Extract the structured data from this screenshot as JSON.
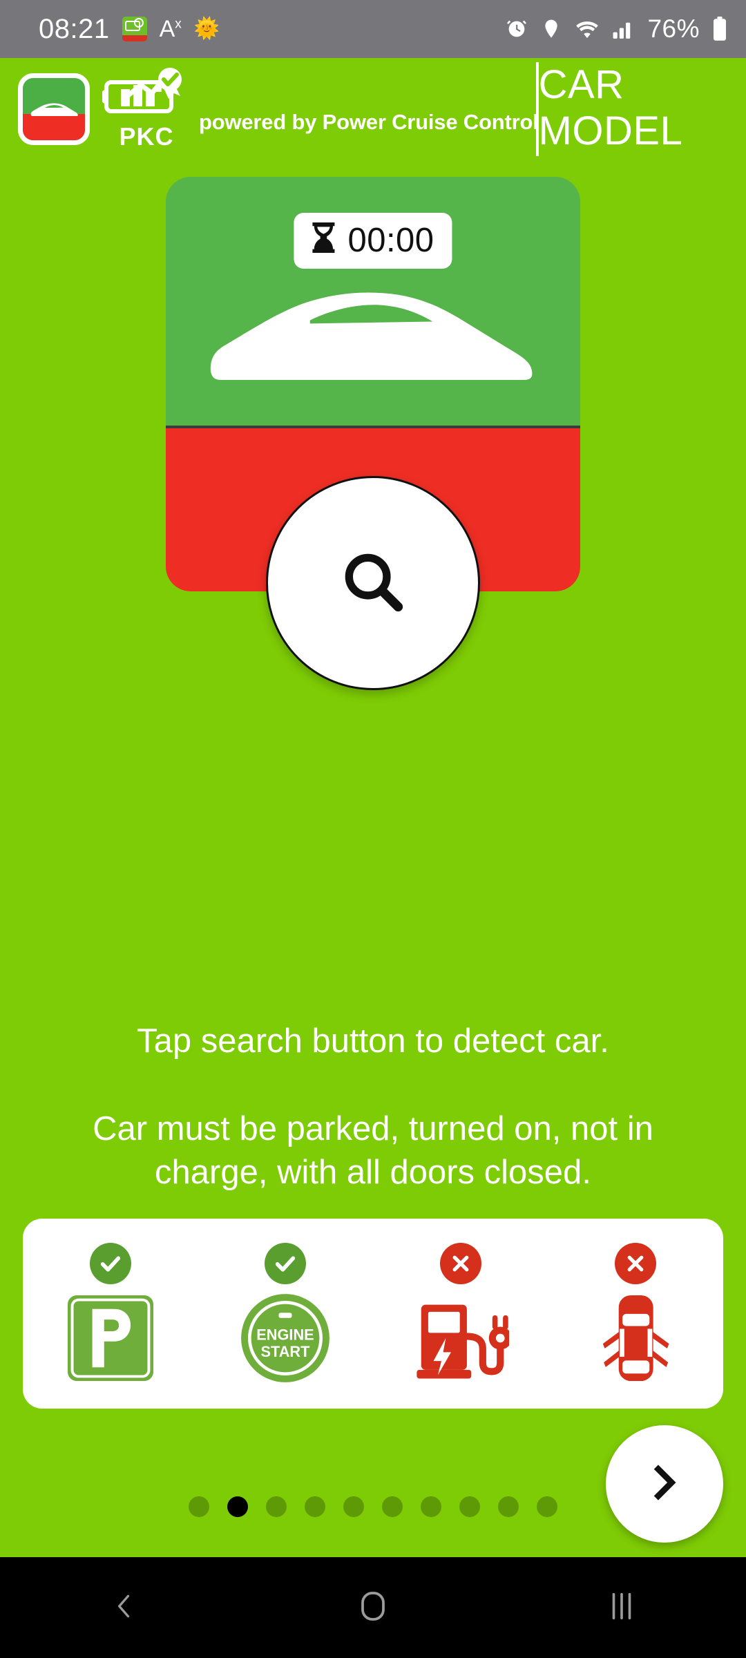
{
  "statusbar": {
    "time": "08:21",
    "battery_percent": "76%",
    "left_icons": [
      {
        "name": "pkc-app-notification-icon",
        "label": "PKC"
      },
      {
        "name": "text-size-ax-icon",
        "label": "A"
      },
      {
        "name": "sun-emoji-icon",
        "label": "☀"
      }
    ],
    "right_icons": [
      {
        "name": "alarm-clock-icon"
      },
      {
        "name": "location-pin-icon"
      },
      {
        "name": "wifi-icon"
      },
      {
        "name": "cellular-signal-icon"
      },
      {
        "name": "battery-icon"
      }
    ]
  },
  "appbar": {
    "app_icon_name": "pkc-app-icon",
    "logo_word": "PKC",
    "powered_by": "powered by Power Cruise Control",
    "title": "CAR MODEL"
  },
  "hero": {
    "timer_icon": "hourglass-icon",
    "timer_value": "00:00",
    "car_silhouette": "car-side-silhouette-icon",
    "search_button_icon": "search-icon"
  },
  "instructions": {
    "primary": "Tap search button to detect car.",
    "secondary": "Car must be parked, turned on, not in charge, with all doors closed."
  },
  "conditions": [
    {
      "name": "condition-parked",
      "status": "ok",
      "badge": "check-icon",
      "art": "parking-p-sign-icon",
      "label": "P"
    },
    {
      "name": "condition-engine-on",
      "status": "ok",
      "badge": "check-icon",
      "art": "engine-start-button-icon",
      "label_line1": "ENGINE",
      "label_line2": "START"
    },
    {
      "name": "condition-not-charging",
      "status": "no",
      "badge": "x-icon",
      "art": "ev-charging-station-icon",
      "label": ""
    },
    {
      "name": "condition-doors-closed",
      "status": "no",
      "badge": "x-icon",
      "art": "car-doors-open-topview-icon",
      "label": ""
    }
  ],
  "pager": {
    "total": 10,
    "active_index": 1,
    "next_label": "›",
    "next_icon": "chevron-right-icon"
  },
  "navbar": [
    {
      "name": "nav-back-button",
      "icon": "chevron-left-icon"
    },
    {
      "name": "nav-home-button",
      "icon": "home-icon"
    },
    {
      "name": "nav-recents-button",
      "icon": "recents-icon"
    }
  ],
  "colors": {
    "background_green": "#7ECC05",
    "card_green": "#55B54B",
    "card_red": "#EE2E24",
    "status_gray": "#77767B",
    "ok_green": "#5A9E2F",
    "no_red": "#D4301B",
    "dot_inactive": "#5E9A06",
    "dot_active": "#000000"
  }
}
